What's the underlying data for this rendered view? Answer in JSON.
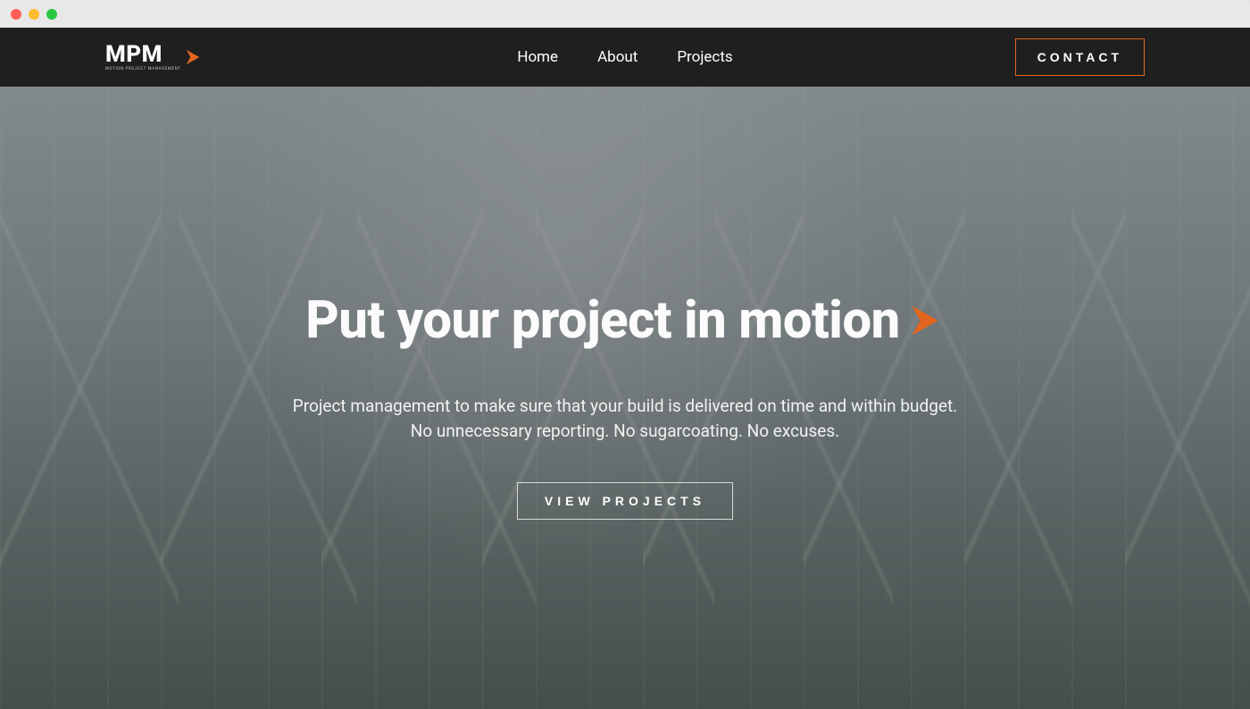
{
  "logo": {
    "text": "MPM",
    "subtext": "MOTION PROJECT MANAGEMENT"
  },
  "nav": {
    "items": [
      "Home",
      "About",
      "Projects"
    ]
  },
  "contact_label": "CONTACT",
  "hero": {
    "title": "Put your project in motion",
    "subtitle_line1": "Project management to make sure that your build is delivered on time and within budget.",
    "subtitle_line2": "No unnecessary reporting. No sugarcoating. No excuses.",
    "cta_label": "VIEW PROJECTS"
  },
  "colors": {
    "accent": "#e2641f"
  }
}
